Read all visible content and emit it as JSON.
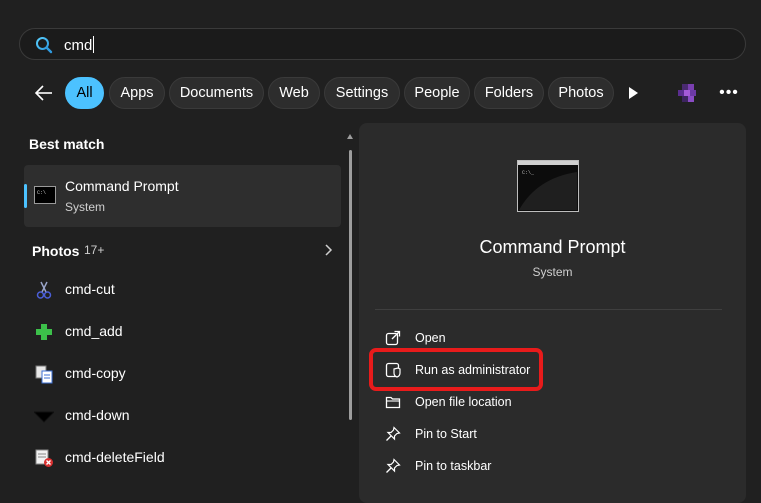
{
  "colors": {
    "accent": "#4cc2ff",
    "highlight": "#e81b1b",
    "background": "#202020"
  },
  "search": {
    "value": "cmd",
    "icon": "search-icon"
  },
  "filters": {
    "back_icon": "back-arrow-icon",
    "tabs": [
      {
        "label": "All",
        "active": true
      },
      {
        "label": "Apps",
        "active": false
      },
      {
        "label": "Documents",
        "active": false
      },
      {
        "label": "Web",
        "active": false
      },
      {
        "label": "Settings",
        "active": false
      },
      {
        "label": "People",
        "active": false
      },
      {
        "label": "Folders",
        "active": false
      },
      {
        "label": "Photos",
        "active": false
      }
    ],
    "more_tabs_icon": "play-icon",
    "more_options_label": "•••"
  },
  "results": {
    "best_match_heading": "Best match",
    "best_match": {
      "title": "Command Prompt",
      "subtitle": "System",
      "icon": "terminal-icon"
    },
    "photos_heading": "Photos",
    "photos_count": "17+",
    "items": [
      {
        "label": "cmd-cut",
        "icon": "scissors-icon"
      },
      {
        "label": "cmd_add",
        "icon": "plus-icon"
      },
      {
        "label": "cmd-copy",
        "icon": "copy-icon"
      },
      {
        "label": "cmd-down",
        "icon": "down-arrow-icon"
      },
      {
        "label": "cmd-deleteField",
        "icon": "delete-field-icon"
      }
    ]
  },
  "details": {
    "title": "Command Prompt",
    "subtitle": "System",
    "actions": [
      {
        "label": "Open",
        "icon": "open-external-icon"
      },
      {
        "label": "Run as administrator",
        "icon": "shield-icon"
      },
      {
        "label": "Open file location",
        "icon": "folder-icon"
      },
      {
        "label": "Pin to Start",
        "icon": "pin-icon"
      },
      {
        "label": "Pin to taskbar",
        "icon": "pin-icon"
      }
    ]
  }
}
